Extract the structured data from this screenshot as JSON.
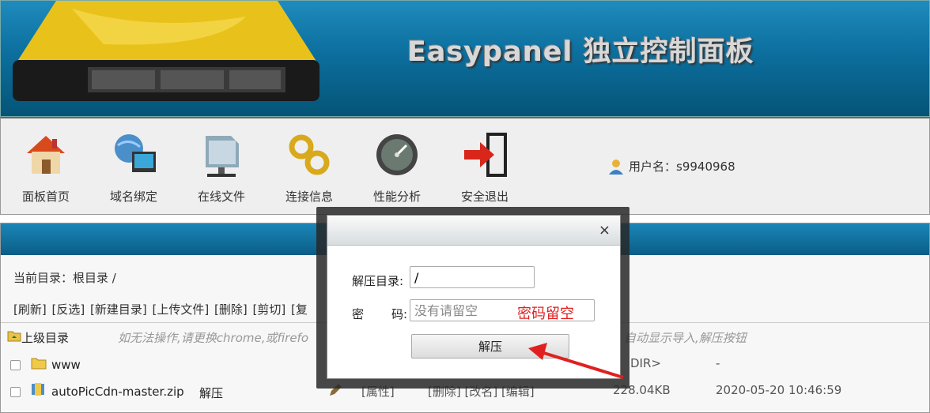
{
  "header": {
    "brand": "Easypanel 独立控制面板"
  },
  "toolbar": {
    "items": [
      {
        "label": "面板首页",
        "icon": "home-icon"
      },
      {
        "label": "域名绑定",
        "icon": "globe-monitor-icon"
      },
      {
        "label": "在线文件",
        "icon": "folder-network-icon"
      },
      {
        "label": "连接信息",
        "icon": "chain-link-icon"
      },
      {
        "label": "性能分析",
        "icon": "gauge-icon"
      },
      {
        "label": "安全退出",
        "icon": "exit-door-icon"
      }
    ],
    "user_label": "用户名：s9940968"
  },
  "files": {
    "current_dir": "当前目录：根目录 /",
    "actions": [
      "[刷新]",
      "[反选]",
      "[新建目录]",
      "[上传文件]",
      "[删除]",
      "[剪切]",
      "[复"
    ],
    "parent_dir": "上级目录",
    "hint": "如无法操作,请更换chrome,或firefo",
    "hint_right": "自动显示导入,解压按钮",
    "rows": [
      {
        "name": "www",
        "type": "folder",
        "size": "DIR>",
        "date": "-"
      },
      {
        "name": "autoPicCdn-master.zip",
        "extra": "解压",
        "type": "zip",
        "ops": "[属性]",
        "ops2": "[删除] [改名] [编辑]",
        "size": "228.04KB",
        "date": "2020-05-20 10:46:59"
      }
    ]
  },
  "dialog": {
    "close": "×",
    "dir_label": "解压目录:",
    "dir_value": "/",
    "pwd_label_1": "密",
    "pwd_label_2": "码:",
    "pwd_placeholder": "没有请留空",
    "pwd_note": "密码留空",
    "submit": "解压"
  },
  "colors": {
    "header": "#0c6f9e",
    "annotation": "#e02020"
  }
}
